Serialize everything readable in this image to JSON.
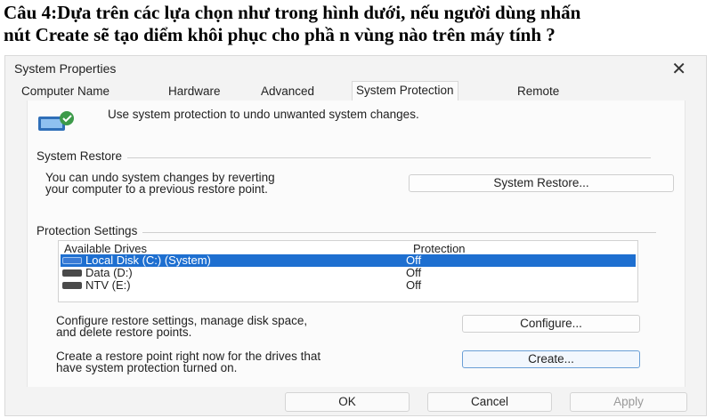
{
  "question": {
    "line1": "Câu 4:Dựa trên các lựa chọn như trong hình dưới, nếu người dùng nhấn",
    "line2": "nút Create sẽ tạo diểm khôi phục cho phầ n vùng nào trên máy tính ?"
  },
  "dialog": {
    "title": "System Properties",
    "close_glyph": "✕",
    "tabs": [
      "Computer Name",
      "Hardware",
      "Advanced",
      "System Protection",
      "Remote"
    ],
    "active_tab": "System Protection",
    "intro_text": "Use system protection to undo unwanted system changes.",
    "restore_group": {
      "label": "System Restore",
      "desc_line1": "You can undo system changes by reverting",
      "desc_line2": "your computer to a previous restore point.",
      "button": "System Restore..."
    },
    "protection_group": {
      "label": "Protection Settings",
      "columns": [
        "Available Drives",
        "Protection"
      ],
      "drives": [
        {
          "name": "Local Disk (C:) (System)",
          "protection": "Off",
          "icon": "system-drive-icon",
          "selected": true
        },
        {
          "name": "Data (D:)",
          "protection": "Off",
          "icon": "drive-icon",
          "selected": false
        },
        {
          "name": "NTV (E:)",
          "protection": "Off",
          "icon": "drive-icon",
          "selected": false
        }
      ],
      "configure_desc_line1": "Configure restore settings, manage disk space,",
      "configure_desc_line2": "and delete restore points.",
      "configure_button": "Configure...",
      "create_desc_line1": "Create a restore point right now for the drives that",
      "create_desc_line2": "have system protection turned on.",
      "create_button": "Create..."
    },
    "footer": {
      "ok": "OK",
      "cancel": "Cancel",
      "apply": "Apply"
    },
    "colors": {
      "selection": "#1e6fd0",
      "focus_border": "#6a9fd6",
      "dialog_bg": "#f3f3f3"
    }
  }
}
